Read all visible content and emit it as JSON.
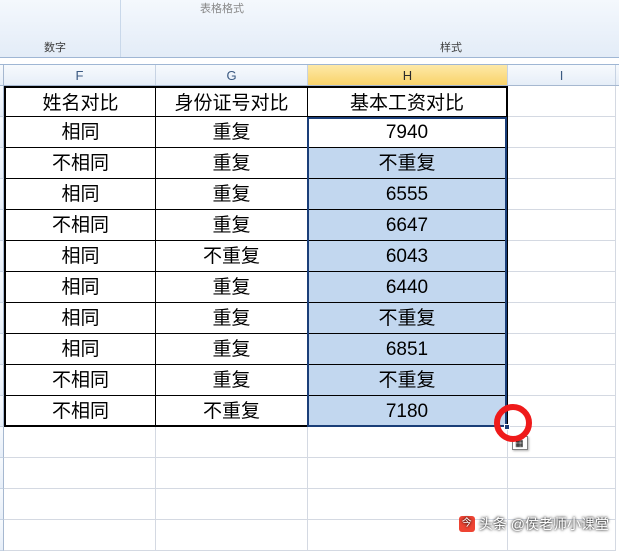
{
  "ribbon": {
    "group_number": "数字",
    "group_style": "样式",
    "truncated_label": "表格格式"
  },
  "columns": {
    "F": "F",
    "G": "G",
    "H": "H",
    "I": "I"
  },
  "header_row": {
    "F": "姓名对比",
    "G": "身份证号对比",
    "H": "基本工资对比"
  },
  "rows": [
    {
      "F": "相同",
      "G": "重复",
      "H": "7940"
    },
    {
      "F": "不相同",
      "G": "重复",
      "H": "不重复"
    },
    {
      "F": "相同",
      "G": "重复",
      "H": "6555"
    },
    {
      "F": "不相同",
      "G": "重复",
      "H": "6647"
    },
    {
      "F": "相同",
      "G": "不重复",
      "H": "6043"
    },
    {
      "F": "相同",
      "G": "重复",
      "H": "6440"
    },
    {
      "F": "相同",
      "G": "重复",
      "H": "不重复"
    },
    {
      "F": "相同",
      "G": "重复",
      "H": "6851"
    },
    {
      "F": "不相同",
      "G": "重复",
      "H": "不重复"
    },
    {
      "F": "不相同",
      "G": "不重复",
      "H": "7180"
    }
  ],
  "selection": {
    "range": "H2:H11",
    "active_cell": "H2"
  },
  "autofill_button": "▦",
  "watermark": {
    "prefix": "头条",
    "author": "@侯老师小课堂"
  }
}
